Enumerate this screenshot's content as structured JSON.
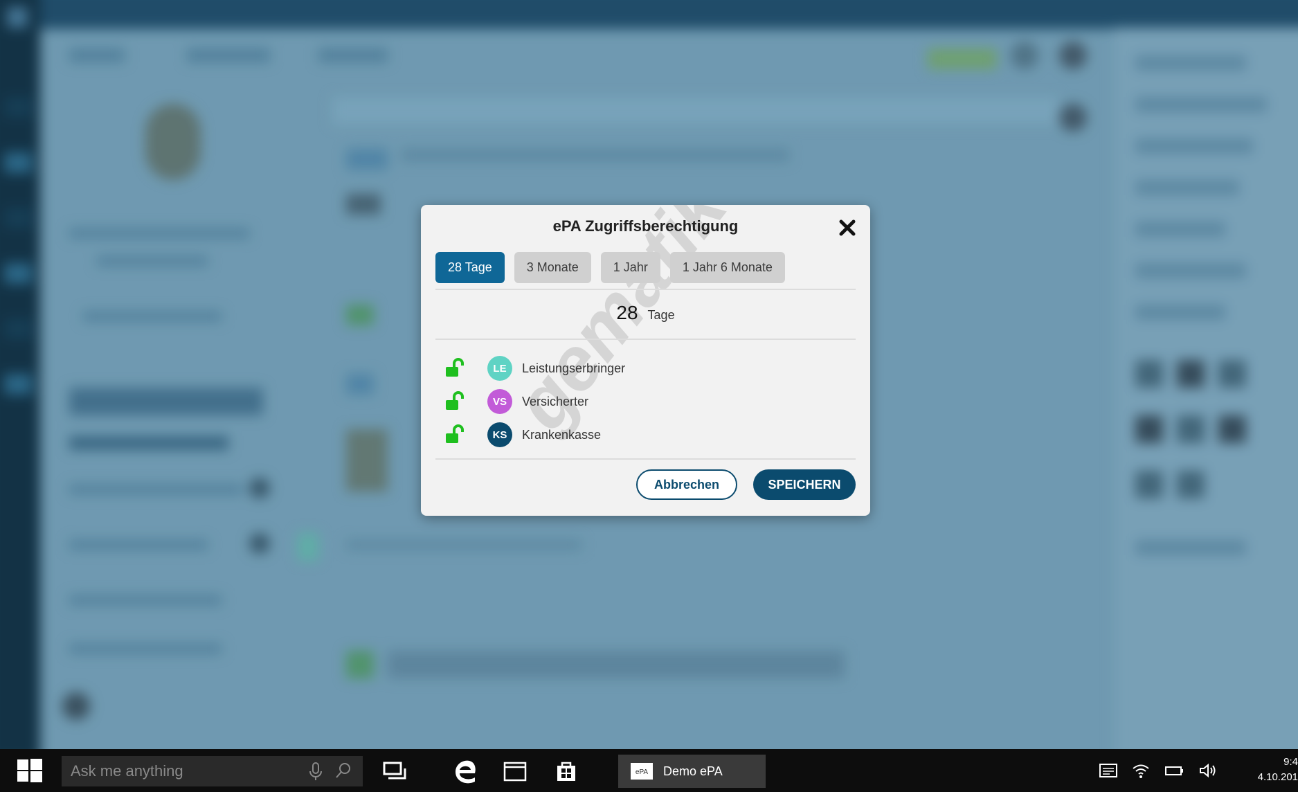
{
  "dialog": {
    "title": "ePA Zugriffsberechtigung",
    "tabs": [
      {
        "label": "28 Tage",
        "active": true
      },
      {
        "label": "3 Monate",
        "active": false
      },
      {
        "label": "1 Jahr",
        "active": false
      },
      {
        "label": "1 Jahr 6 Monate",
        "active": false
      }
    ],
    "duration_value": "28",
    "duration_unit": "Tage",
    "permissions": [
      {
        "badge": "LE",
        "label": "Leistungserbringer",
        "color": "#5fd3c4",
        "unlocked": true
      },
      {
        "badge": "VS",
        "label": "Versicherter",
        "color": "#c25bd8",
        "unlocked": true
      },
      {
        "badge": "KS",
        "label": "Krankenkasse",
        "color": "#0b4b6e",
        "unlocked": true
      }
    ],
    "cancel_label": "Abbrechen",
    "save_label": "SPEICHERN",
    "watermark": "gematik"
  },
  "taskbar": {
    "search_placeholder": "Ask me anything",
    "app_label": "Demo ePA",
    "app_icon_text": "ePA",
    "clock_time": "9:4",
    "clock_date": "4.10.201"
  },
  "colors": {
    "primary": "#0b4b6e",
    "tab_active": "#0f6797",
    "lock_green": "#1fbf1f"
  }
}
